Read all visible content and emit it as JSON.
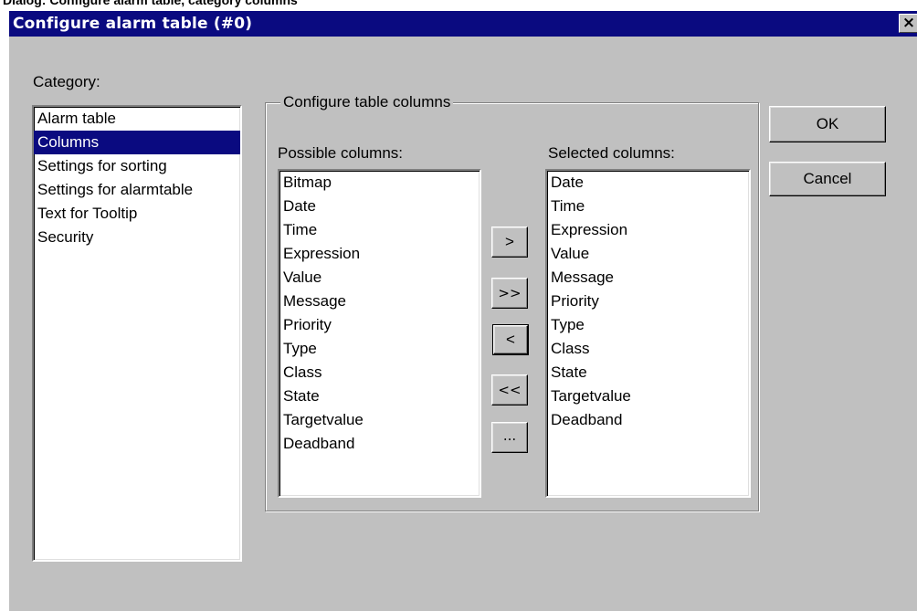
{
  "caption": "Dialog: Configure alarm table, category columns",
  "window": {
    "title": "Configure alarm table (#0)",
    "close_label": "×"
  },
  "category": {
    "label": "Category:",
    "items": [
      "Alarm table",
      "Columns",
      "Settings for sorting",
      "Settings for alarmtable",
      "Text for Tooltip",
      "Security"
    ],
    "selected": "Columns"
  },
  "group": {
    "title": "Configure table columns"
  },
  "possible": {
    "label": "Possible columns:",
    "items": [
      "Bitmap",
      "Date",
      "Time",
      "Expression",
      "Value",
      "Message",
      "Priority",
      "Type",
      "Class",
      "State",
      "Targetvalue",
      "Deadband"
    ]
  },
  "selected_cols": {
    "label": "Selected columns:",
    "items": [
      "Date",
      "Time",
      "Expression",
      "Value",
      "Message",
      "Priority",
      "Type",
      "Class",
      "State",
      "Targetvalue",
      "Deadband"
    ]
  },
  "transfer": {
    "add": ">",
    "add_all": ">>",
    "remove": "<",
    "remove_all": "<<",
    "more": "..."
  },
  "buttons": {
    "ok": "OK",
    "cancel": "Cancel"
  }
}
